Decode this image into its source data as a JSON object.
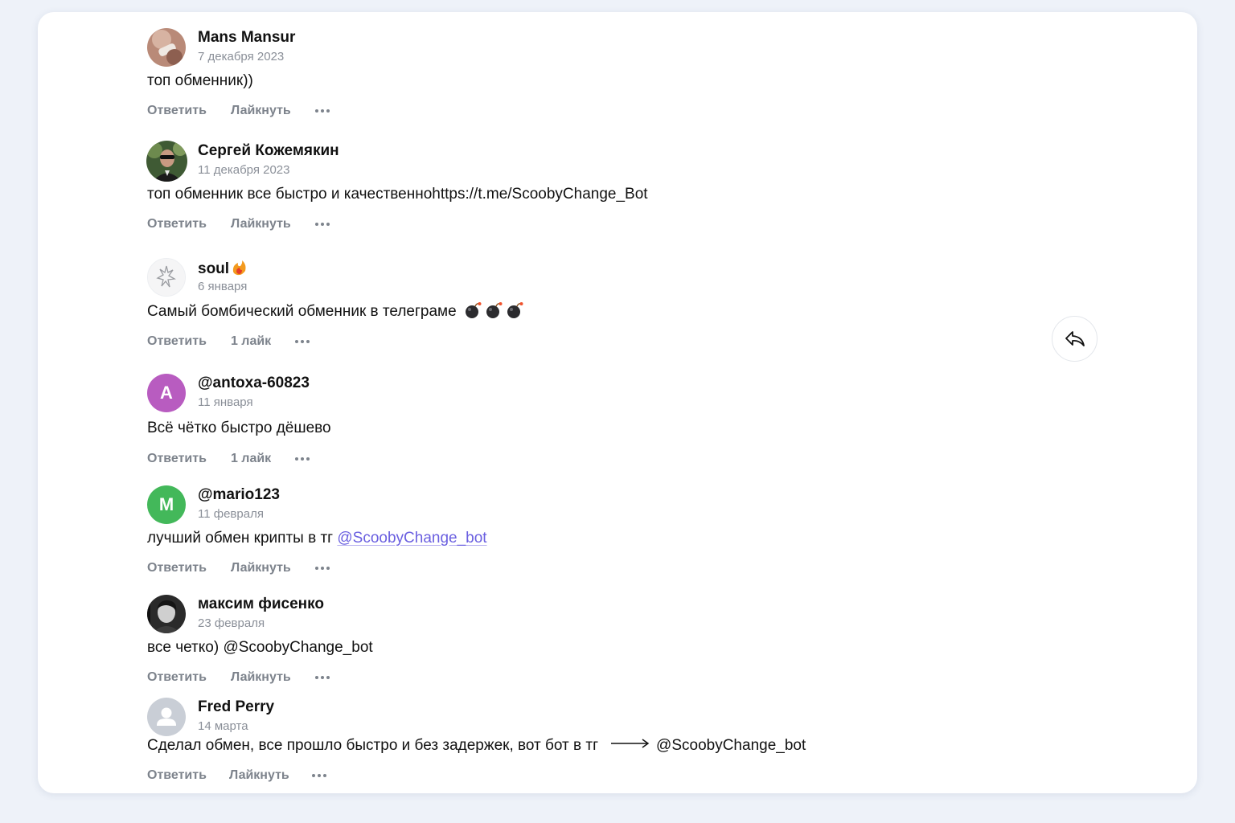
{
  "colors": {
    "page_bg": "#eef2f9",
    "card_bg": "#ffffff",
    "link": "#6a5fe0",
    "muted": "#8a8f98",
    "avatar_a": "#b85cc0",
    "avatar_m": "#43b85a",
    "avatar_default": "#c9ced6"
  },
  "actions": {
    "reply": "Ответить",
    "like": "Лайкнуть",
    "more_icon": "more-dots-icon"
  },
  "comments": [
    {
      "author": "Mans Mansur",
      "date": "7 декабря 2023",
      "text": "топ обменник))",
      "like_label": "Лайкнуть",
      "avatar": "photo"
    },
    {
      "author": "Сергей Кожемякин",
      "date": "11 декабря 2023",
      "text": "топ обменник все быстро и качественноhttps://t.me/ScoobyChange_Bot",
      "like_label": "Лайкнуть",
      "avatar": "photo"
    },
    {
      "author": "soul",
      "author_icon": "flame-emoji",
      "date": "6 января",
      "text": "Самый бомбический обменник в телеграме",
      "text_icons": [
        "bomb-emoji",
        "bomb-emoji",
        "bomb-emoji"
      ],
      "like_label": "1 лайк",
      "avatar": "photo"
    },
    {
      "author": "@antoxa-60823",
      "date": "11 января",
      "text": "Всё чётко быстро дёшево",
      "like_label": "1 лайк",
      "avatar": "A"
    },
    {
      "author": "@mario123",
      "date": "11 февраля",
      "text": "лучший обмен крипты в тг",
      "link_text": "@ScoobyChange_bot",
      "like_label": "Лайкнуть",
      "avatar": "M"
    },
    {
      "author": "максим фисенко",
      "date": "23 февраля",
      "text": "все четко) @ScoobyChange_bot",
      "like_label": "Лайкнуть",
      "avatar": "photo"
    },
    {
      "author": "Fred Perry",
      "date": "14 марта",
      "text": "Сделал обмен, все прошло быстро и без задержек, вот бот в тг",
      "text_tail": "@ScoobyChange_bot",
      "like_label": "Лайкнуть",
      "avatar": "default-user-icon"
    }
  ],
  "share_button_icon": "reply-arrow-icon"
}
